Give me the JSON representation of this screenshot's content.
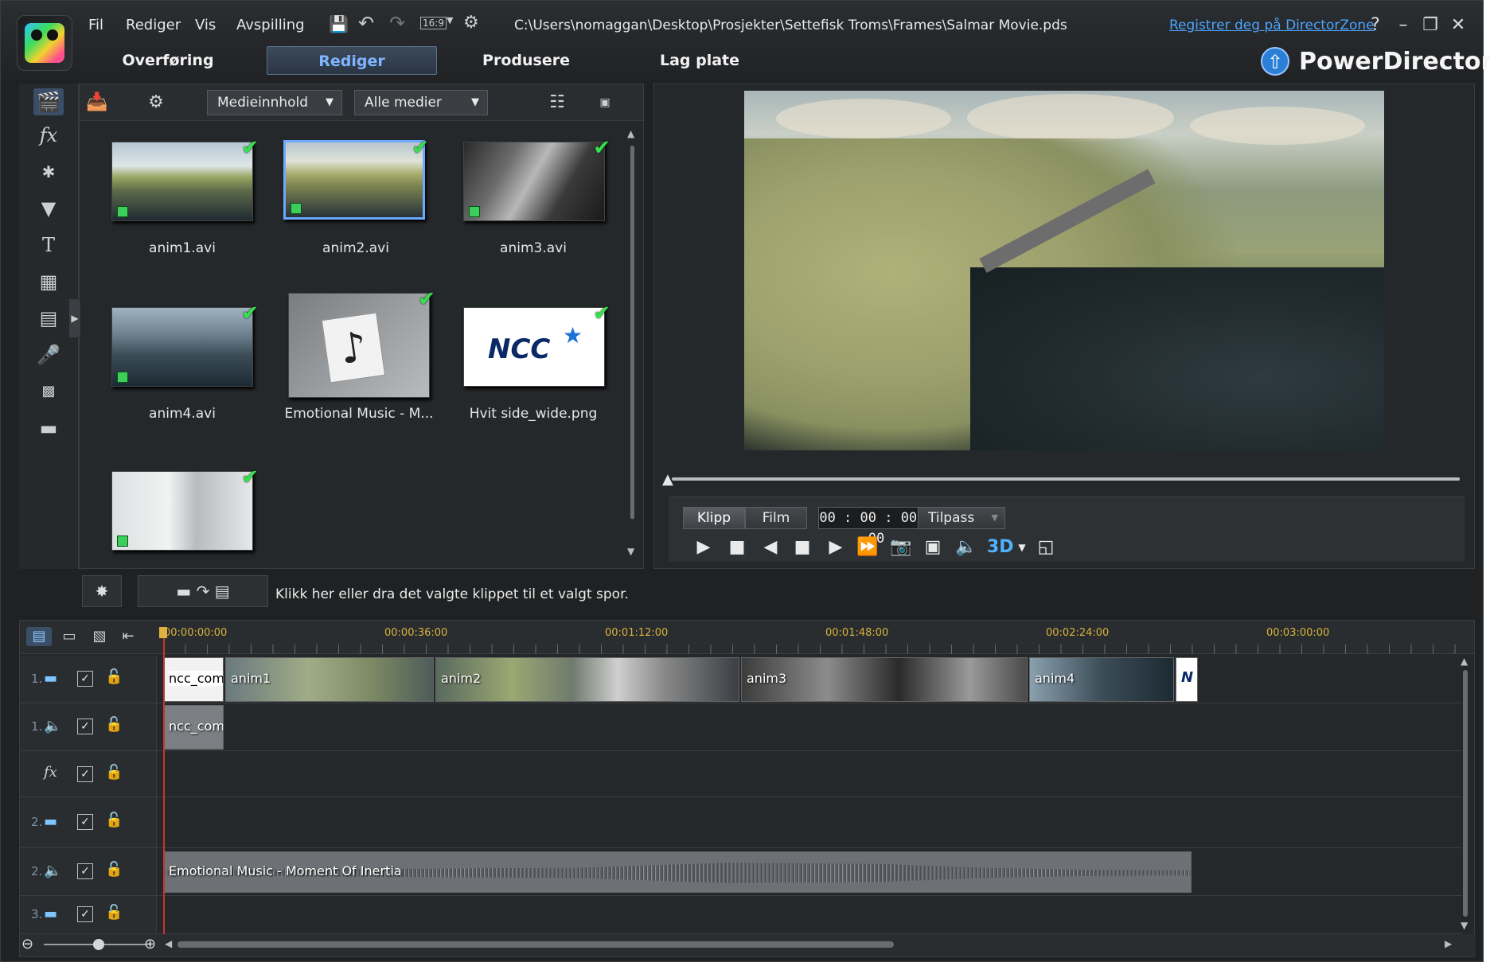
{
  "window": {
    "menu": [
      "Fil",
      "Rediger",
      "Vis",
      "Avspilling"
    ],
    "path": "C:\\Users\\nomaggan\\Desktop\\Prosjekter\\Settefisk Troms\\Frames\\Salmar Movie.pds",
    "register_link": "Registrer deg på DirectorZone",
    "brand": "PowerDirector",
    "aspect_label": "16:9"
  },
  "tabs": [
    "Overføring",
    "Rediger",
    "Produsere",
    "Lag plate"
  ],
  "active_tab": "Rediger",
  "library": {
    "content_dropdown": "Medieinnhold",
    "filter_dropdown": "Alle medier",
    "items": [
      {
        "label": "anim1.avi",
        "kind": "video",
        "selected": false
      },
      {
        "label": "anim2.avi",
        "kind": "video",
        "selected": true
      },
      {
        "label": "anim3.avi",
        "kind": "video",
        "selected": false
      },
      {
        "label": "anim4.avi",
        "kind": "video",
        "selected": false
      },
      {
        "label": "Emotional Music - M...",
        "kind": "audio",
        "selected": false
      },
      {
        "label": "Hvit side_wide.png",
        "kind": "image",
        "selected": false,
        "logo_text": "NCC"
      },
      {
        "label": "",
        "kind": "video",
        "selected": false
      }
    ]
  },
  "preview": {
    "mode_clip": "Klipp",
    "mode_film": "Film",
    "timecode": "00 : 00 : 00 : 00",
    "fit_dropdown": "Tilpass",
    "three_d_label": "3D"
  },
  "actionbar": {
    "hint": "Klikk her eller dra det valgte klippet til et valgt spor."
  },
  "timeline": {
    "ruler": [
      "00:00:00:00",
      "00:00:36:00",
      "00:01:12:00",
      "00:01:48:00",
      "00:02:24:00",
      "00:03:00:00"
    ],
    "tracks": [
      {
        "num": "1.",
        "type": "video",
        "clips": [
          "ncc_com",
          "anim1",
          "anim2",
          "anim3",
          "anim4"
        ]
      },
      {
        "num": "1.",
        "type": "audio",
        "clips": [
          "ncc_com"
        ]
      },
      {
        "num": "",
        "type": "fx",
        "clips": []
      },
      {
        "num": "2.",
        "type": "video",
        "clips": []
      },
      {
        "num": "2.",
        "type": "audio",
        "clips": [
          "Emotional Music - Moment Of Inertia"
        ]
      },
      {
        "num": "3.",
        "type": "video",
        "clips": []
      }
    ]
  },
  "colors": {
    "accent": "#4fb3ff",
    "check": "#34e24b",
    "playhead": "#c83434",
    "ruler_text": "#d9b23a"
  }
}
